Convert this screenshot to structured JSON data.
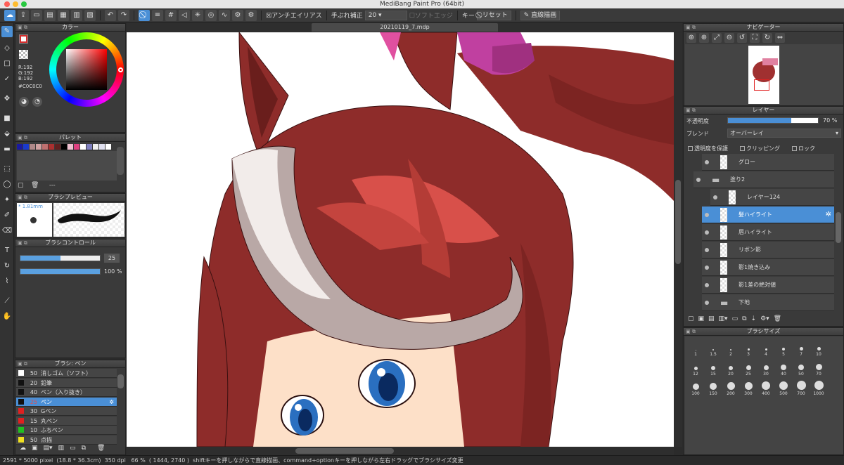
{
  "window": {
    "title": "MediBang Paint Pro (64bit)"
  },
  "toolbar": {
    "antialias": "アンチエイリアス",
    "stabilizer_label": "手ぶれ補正",
    "stabilizer_value": "20",
    "soft_edge": "ソフトエッジ",
    "key_label": "キー",
    "reset_label": "リセット",
    "straight_label": "直線描画"
  },
  "document": {
    "tab": "20210119_7.mdp"
  },
  "color_panel": {
    "title": "カラー",
    "r": "R:192",
    "g": "G:192",
    "b": "B:192",
    "hex": "#C0C0C0",
    "primary": "#d32f2f",
    "secondary": "#c0c0c0"
  },
  "palette_panel": {
    "title": "パレット",
    "colors": [
      "#1a1aa0",
      "#1a3acc",
      "#b08888",
      "#d0a0a0",
      "#c07070",
      "#aa3030",
      "#602020",
      "#000000",
      "#f0c0d0",
      "#e04080",
      "#ffffff",
      "#8080c0",
      "#f0f0f0",
      "#e0e0f0",
      "#ffffff"
    ],
    "footer_text": "---"
  },
  "brush_preview": {
    "title": "ブラシプレビュー",
    "size": "* 1.81mm"
  },
  "brush_control": {
    "title": "ブラシコントロール",
    "size_value": "25",
    "opacity_value": "100 %",
    "size_ratio": 0.5,
    "opacity_ratio": 1.0
  },
  "brush_panel": {
    "title": "ブラシ: ペン",
    "items": [
      {
        "size": "50",
        "name": "消しゴム（ソフト）",
        "color": "#ffffff"
      },
      {
        "size": "20",
        "name": "鉛筆",
        "color": "#111111"
      },
      {
        "size": "40",
        "name": "ペン（入り抜き）",
        "color": "#111111"
      },
      {
        "size": "25",
        "name": "ペン",
        "color": "#111111"
      },
      {
        "size": "30",
        "name": "Gペン",
        "color": "#e02020"
      },
      {
        "size": "15",
        "name": "丸ペン",
        "color": "#e02020"
      },
      {
        "size": "10",
        "name": "ふちペン",
        "color": "#20c020"
      },
      {
        "size": "50",
        "name": "点描",
        "color": "#f0e020"
      }
    ],
    "selected_index": 3
  },
  "navigator": {
    "title": "ナビゲーター"
  },
  "layer_panel": {
    "title": "レイヤー",
    "opacity_label": "不透明度",
    "opacity_value": "70 %",
    "opacity_ratio": 0.7,
    "blend_label": "ブレンド",
    "blend_value": "オーバーレイ",
    "protect_label": "透明度を保護",
    "clipping_label": "クリッピング",
    "lock_label": "ロック",
    "layers": [
      {
        "name": "グロー",
        "indent": 2,
        "type": "layer"
      },
      {
        "name": "塗り2",
        "indent": 1,
        "type": "folder"
      },
      {
        "name": "レイヤー124",
        "indent": 3,
        "type": "layer"
      },
      {
        "name": "髪ハイライト",
        "indent": 2,
        "type": "layer"
      },
      {
        "name": "唇ハイライト",
        "indent": 2,
        "type": "layer"
      },
      {
        "name": "リボン影",
        "indent": 2,
        "type": "layer"
      },
      {
        "name": "影1焼き込み",
        "indent": 2,
        "type": "layer"
      },
      {
        "name": "影1差の絶対値",
        "indent": 2,
        "type": "layer"
      },
      {
        "name": "下地",
        "indent": 2,
        "type": "folder"
      }
    ],
    "selected_index": 3
  },
  "brush_size_panel": {
    "title": "ブラシサイズ",
    "sizes": [
      "1",
      "1.5",
      "2",
      "3",
      "4",
      "5",
      "7",
      "10",
      "12",
      "15",
      "20",
      "25",
      "30",
      "40",
      "50",
      "70",
      "100",
      "150",
      "200",
      "300",
      "400",
      "500",
      "700",
      "1000"
    ]
  },
  "status": {
    "dimensions": "2591 * 5000 pixel",
    "physical": "(18.8 * 36.3cm)",
    "dpi": "350 dpi",
    "zoom": "66 %",
    "coords": "( 1444, 2740 )",
    "hint": "shiftキーを押しながらで直線描画、command+optionキーを押しながら左右ドラッグでブラシサイズ変更"
  }
}
